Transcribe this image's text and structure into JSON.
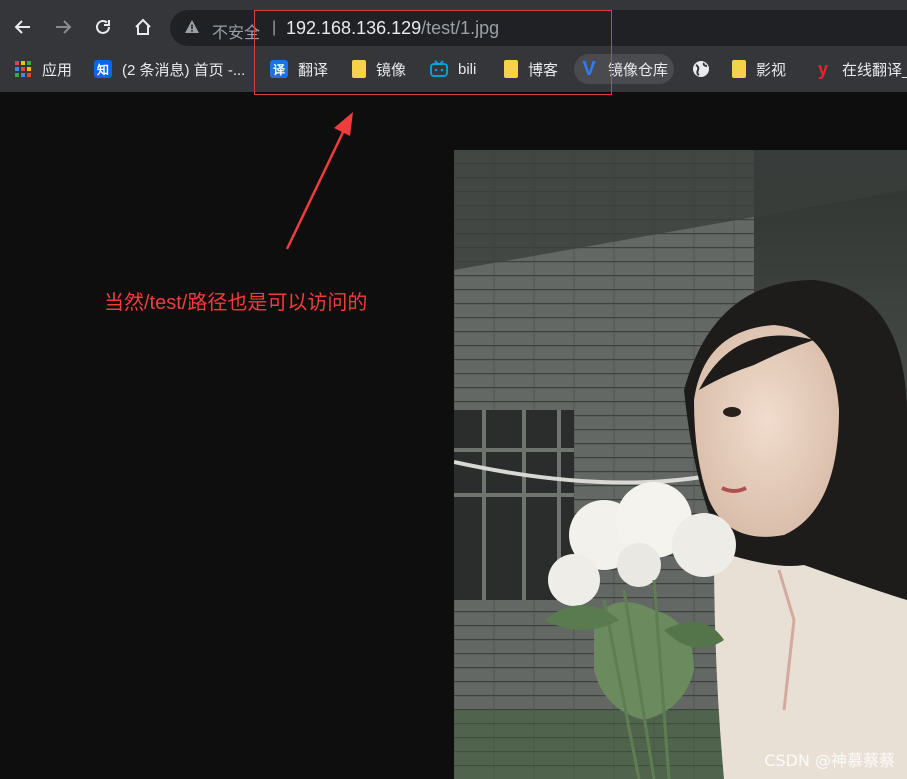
{
  "browser": {
    "security_label": "不安全",
    "separator": "|",
    "url_host": "192.168.136.129",
    "url_path": "/test/1.jpg"
  },
  "bookmarks": [
    {
      "label": "应用",
      "icon": "apps-grid-icon"
    },
    {
      "label": "(2 条消息) 首页 -...",
      "icon": "zhihu-icon",
      "icon_text": "知"
    },
    {
      "label": "翻译",
      "icon": "translate-icon",
      "icon_text": "译"
    },
    {
      "label": "镜像",
      "icon": "folder-icon"
    },
    {
      "label": "bili",
      "icon": "bilibili-icon"
    },
    {
      "label": "博客",
      "icon": "folder-icon"
    },
    {
      "label": "镜像仓库",
      "icon": "v-logo-icon",
      "icon_text": "V"
    },
    {
      "label": "",
      "icon": "globe-icon"
    },
    {
      "label": "影视",
      "icon": "folder-icon"
    },
    {
      "label": "在线翻译_",
      "icon": "youdao-icon",
      "icon_text": "y"
    }
  ],
  "annotation": {
    "text": "当然/test/路径也是可以访问的",
    "color": "#f03c3c"
  },
  "watermark": "CSDN @神慕蔡蔡"
}
